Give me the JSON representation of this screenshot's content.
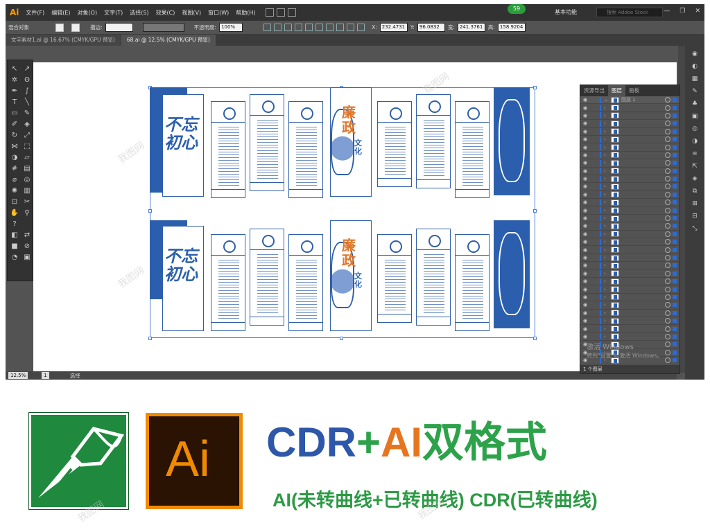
{
  "app": {
    "logo": "Ai",
    "badge": "59"
  },
  "menu": [
    "文件(F)",
    "编辑(E)",
    "对象(O)",
    "文字(T)",
    "选择(S)",
    "效果(C)",
    "视图(V)",
    "窗口(W)",
    "帮助(H)"
  ],
  "workspace": "基本功能",
  "stock_search_placeholder": "搜索 Adobe Stock",
  "control_bar": {
    "selection": "混合对象",
    "stroke_label": "描边:",
    "opacity_label": "不透明度:",
    "opacity_value": "100%",
    "x_label": "X:",
    "x_value": "232.4731",
    "y_label": "Y:",
    "y_value": "96.0832",
    "w_label": "宽:",
    "w_value": "241.3761",
    "h_label": "高:",
    "h_value": "158.9204"
  },
  "tabs": [
    {
      "label": "文字素材1.ai @ 16.67% (CMYK/GPU 预览)",
      "active": false
    },
    {
      "label": "68.ai @ 12.5% (CMYK/GPU 预览)",
      "active": true
    }
  ],
  "status": {
    "zoom": "12.5%",
    "page": "1",
    "tool": "选择"
  },
  "layers_panel": {
    "tabs": [
      "资源导出",
      "图层",
      "画板"
    ],
    "active_tab": "图层",
    "top_layer": "图层 1",
    "footer": "1 个图层"
  },
  "windows_watermark": {
    "line1": "激活 Windows",
    "line2": "转到\"设置\"以激活 Windows。"
  },
  "artwork": {
    "brush_calligraphy": "不忘初心",
    "brand_title": "廉政",
    "brand_subtitle": "文化"
  },
  "site_watermark": "我图网",
  "banner": {
    "headline_cdr": "CDR",
    "headline_plus": "+",
    "headline_ai": "AI",
    "headline_fmt": "双格式",
    "subline": "AI(未转曲线+已转曲线) CDR(已转曲线)",
    "ai_icon_text": "Ai"
  },
  "colors": {
    "accent_blue": "#2b5fae",
    "cdr_blue": "#2d57a8",
    "green": "#2da24a",
    "orange": "#e5761f"
  }
}
